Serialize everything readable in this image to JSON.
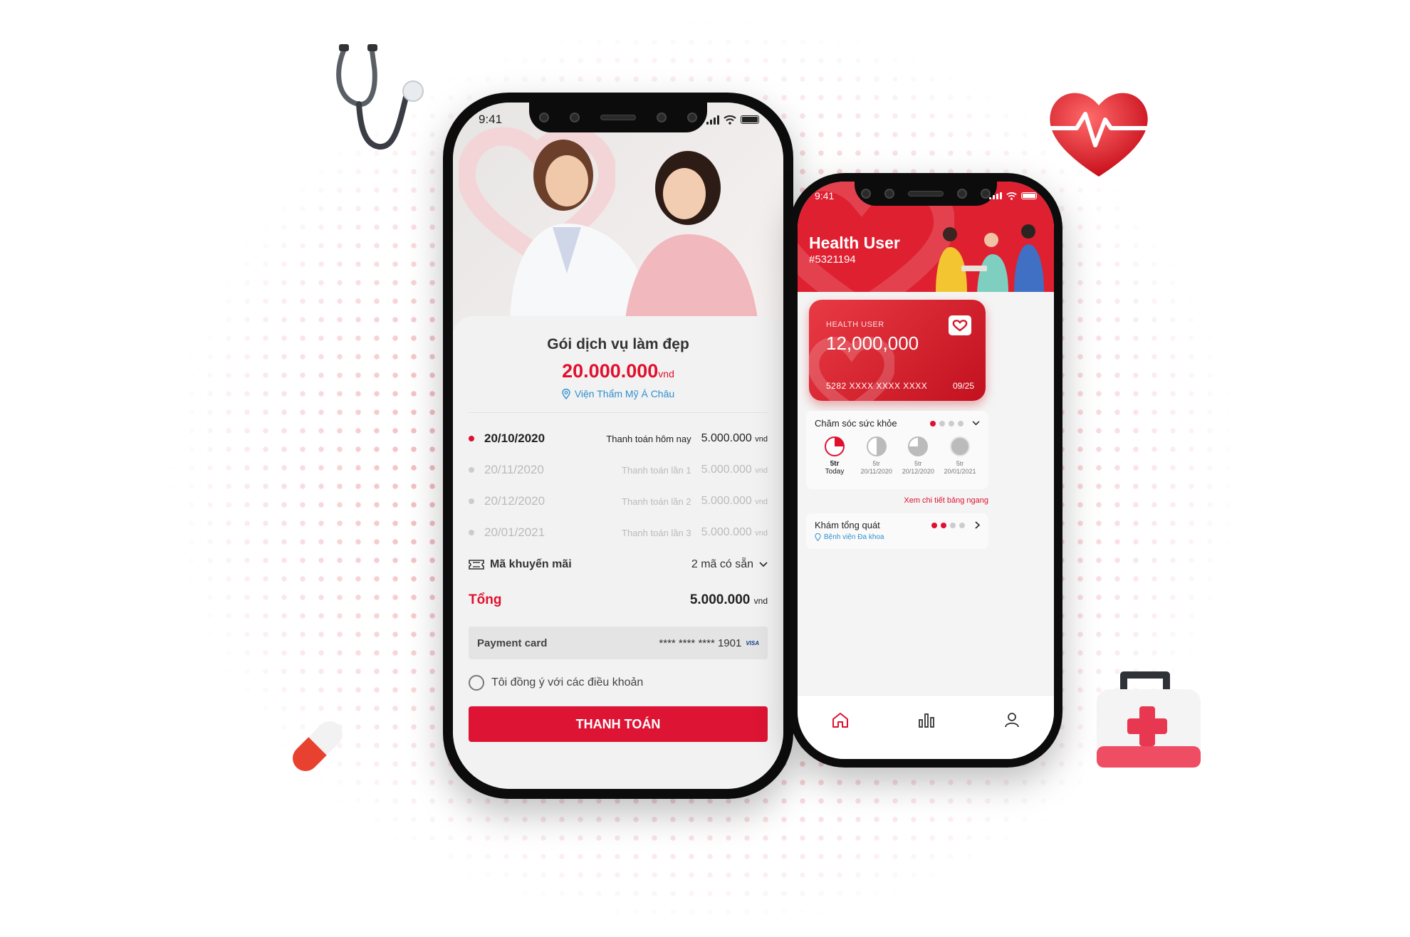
{
  "colors": {
    "brand_red": "#df2031",
    "accent_blue": "#2e8fcf"
  },
  "left_phone": {
    "status_time": "9:41",
    "package": {
      "title": "Gói dịch vụ làm đẹp",
      "price": "20.000.000",
      "currency": "vnd",
      "location": "Viện Thẩm Mỹ Á Châu"
    },
    "schedule": [
      {
        "date": "20/10/2020",
        "desc": "Thanh toán hôm nay",
        "amount": "5.000.000",
        "currency": "vnd"
      },
      {
        "date": "20/11/2020",
        "desc": "Thanh toán lần 1",
        "amount": "5.000.000",
        "currency": "vnd"
      },
      {
        "date": "20/12/2020",
        "desc": "Thanh toán lần 2",
        "amount": "5.000.000",
        "currency": "vnd"
      },
      {
        "date": "20/01/2021",
        "desc": "Thanh toán lần 3",
        "amount": "5.000.000",
        "currency": "vnd"
      }
    ],
    "promo": {
      "label": "Mã khuyến mãi",
      "value": "2 mã có sẵn"
    },
    "total": {
      "label": "Tổng",
      "amount": "5.000.000",
      "currency": "vnd"
    },
    "payment_card": {
      "label": "Payment card",
      "number": "**** **** **** 1901",
      "brand": "VISA"
    },
    "agree_label": "Tôi đồng ý với các điều khoản",
    "pay_button": "THANH TOÁN"
  },
  "right_phone": {
    "status_time": "9:41",
    "user_name": "Health User",
    "user_id": "#5321194",
    "card": {
      "label": "HEALTH USER",
      "balance": "12,000,000",
      "number": "5282 XXXX XXXX XXXX",
      "expiry": "09/25"
    },
    "care": {
      "title": "Chăm sóc sức khỏe",
      "progress_filled": 1,
      "progress_total": 4,
      "items": [
        {
          "amount": "5tr",
          "date": "Today",
          "fraction": 0.25
        },
        {
          "amount": "5tr",
          "date": "20/11/2020",
          "fraction": 0.5
        },
        {
          "amount": "5tr",
          "date": "20/12/2020",
          "fraction": 0.75
        },
        {
          "amount": "5tr",
          "date": "20/01/2021",
          "fraction": 1.0
        }
      ]
    },
    "detail_link": "Xem chi tiết bảng ngang",
    "exam": {
      "title": "Khám tổng quát",
      "location": "Bệnh viện Đa khoa",
      "progress_filled": 2,
      "progress_total": 4
    },
    "tabs": [
      "home-icon",
      "chart-icon",
      "profile-icon"
    ]
  }
}
